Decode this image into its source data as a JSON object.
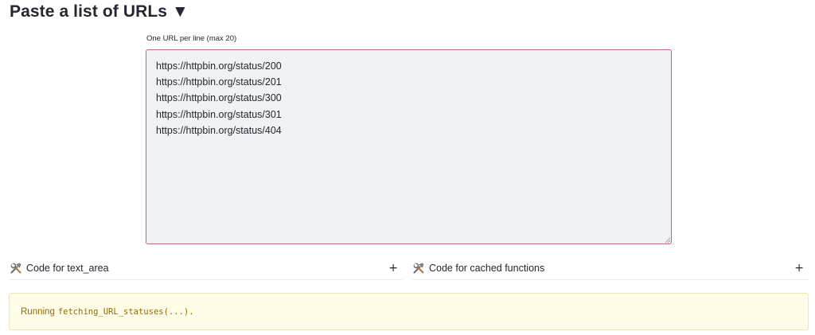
{
  "header": {
    "title": "Paste a list of URLs ▼"
  },
  "url_input": {
    "label": "One URL per line (max 20)",
    "value": "https://httpbin.org/status/200\nhttps://httpbin.org/status/201\nhttps://httpbin.org/status/300\nhttps://httpbin.org/status/301\nhttps://httpbin.org/status/404",
    "accent_color": "#f04e7a"
  },
  "expanders": [
    {
      "label": "Code for text_area",
      "icon": "hammer-and-wrench-icon",
      "toggle": "+"
    },
    {
      "label": "Code for cached functions",
      "icon": "hammer-and-wrench-icon",
      "toggle": "+"
    }
  ],
  "status_alert": {
    "prefix": "Running",
    "code": "fetching_URL_statuses(...).",
    "background": "#fffce7",
    "text_color": "#926c05"
  }
}
